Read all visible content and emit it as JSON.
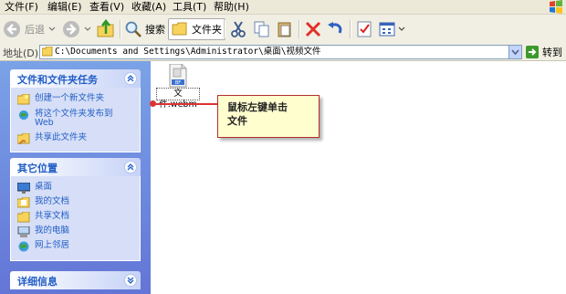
{
  "menu": [
    "文件(F)",
    "编辑(E)",
    "查看(V)",
    "收藏(A)",
    "工具(T)",
    "帮助(H)"
  ],
  "toolbar": {
    "back_label": "后退",
    "search_label": "搜索",
    "folders_label": "文件夹"
  },
  "address": {
    "label": "地址(D)",
    "path": "C:\\Documents and Settings\\Administrator\\桌面\\视频文件",
    "go_label": "转到"
  },
  "tasks_panel": {
    "title": "文件和文件夹任务",
    "items": [
      "创建一个新文件夹",
      "将这个文件夹发布到",
      "Web",
      "共享此文件夹"
    ]
  },
  "places_panel": {
    "title": "其它位置",
    "items": [
      "桌面",
      "我的文档",
      "共享文档",
      "我的电脑",
      "网上邻居"
    ]
  },
  "details_panel": {
    "title": "详细信息"
  },
  "file": {
    "name": "文件.webm",
    "badge": "BF"
  },
  "callout": {
    "line1": "鼠标左键单击",
    "line2": "文件"
  },
  "colors": {
    "accent": "#215dc6",
    "callout_border": "#b03030",
    "callout_fill": "#fefecf",
    "pointer": "#dd3333"
  }
}
